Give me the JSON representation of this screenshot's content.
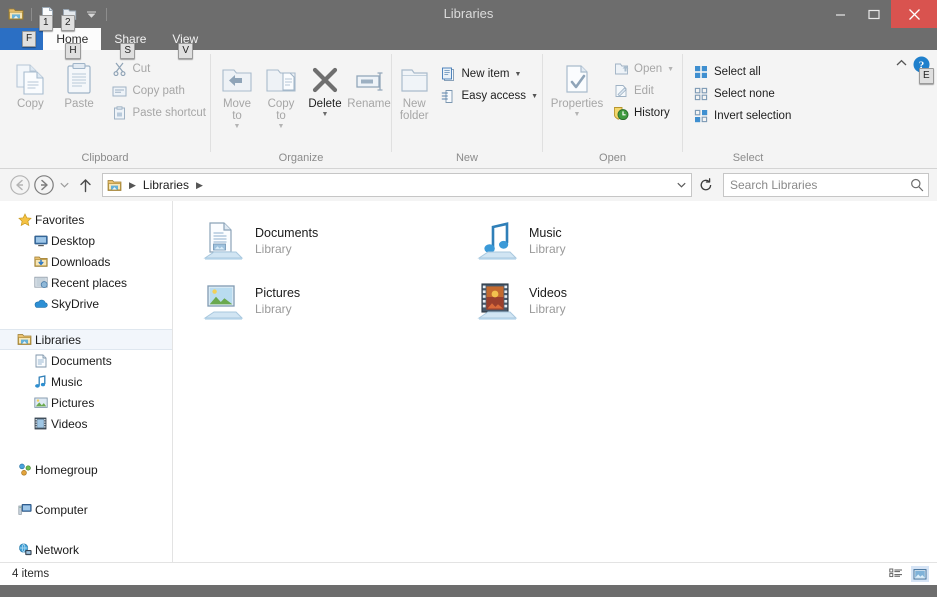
{
  "window": {
    "title": "Libraries",
    "controls": {
      "minimize": "minimize",
      "maximize": "maximize",
      "close": "close"
    }
  },
  "quick_access": {
    "keytips": [
      "1",
      "2"
    ],
    "dropdown": "customize-quick-access-toolbar"
  },
  "tabs": [
    {
      "label": "F",
      "name": "file-tab",
      "keytip": "F",
      "active": false
    },
    {
      "label": "Home",
      "name": "tab-home",
      "keytip": "H",
      "active": true
    },
    {
      "label": "Share",
      "name": "tab-share",
      "keytip": "S",
      "active": false
    },
    {
      "label": "View",
      "name": "tab-view",
      "keytip": "V",
      "active": false
    }
  ],
  "ribbon": {
    "help_keytip": "E",
    "groups": [
      {
        "label": "Clipboard",
        "big_buttons": [
          {
            "label": "Copy",
            "icon": "copy-icon",
            "disabled": true
          },
          {
            "label": "Paste",
            "icon": "paste-icon",
            "disabled": true
          }
        ],
        "small_buttons": [
          {
            "label": "Cut",
            "icon": "cut-icon",
            "disabled": true
          },
          {
            "label": "Copy path",
            "icon": "copy-path-icon",
            "disabled": true
          },
          {
            "label": "Paste shortcut",
            "icon": "paste-shortcut-icon",
            "disabled": true
          }
        ]
      },
      {
        "label": "Organize",
        "big_buttons": [
          {
            "label": "Move\nto",
            "icon": "move-to-icon",
            "disabled": true,
            "caret": true
          },
          {
            "label": "Copy\nto",
            "icon": "copy-to-icon",
            "disabled": true,
            "caret": true
          },
          {
            "label": "Delete",
            "icon": "delete-icon",
            "disabled": false,
            "caret": true
          },
          {
            "label": "Rename",
            "icon": "rename-icon",
            "disabled": true
          }
        ]
      },
      {
        "label": "New",
        "big_buttons": [
          {
            "label": "New\nfolder",
            "icon": "new-folder-icon",
            "disabled": true
          }
        ],
        "small_buttons": [
          {
            "label": "New item",
            "icon": "new-item-icon",
            "disabled": false,
            "caret": true
          },
          {
            "label": "Easy access",
            "icon": "easy-access-icon",
            "disabled": false,
            "caret": true
          }
        ]
      },
      {
        "label": "Open",
        "big_buttons": [
          {
            "label": "Properties",
            "icon": "properties-icon",
            "disabled": true,
            "caret": true
          }
        ],
        "small_buttons": [
          {
            "label": "Open",
            "icon": "open-icon",
            "disabled": true,
            "caret": true
          },
          {
            "label": "Edit",
            "icon": "edit-icon",
            "disabled": true
          },
          {
            "label": "History",
            "icon": "history-icon",
            "disabled": false
          }
        ]
      },
      {
        "label": "Select",
        "small_buttons": [
          {
            "label": "Select all",
            "icon": "select-all-icon",
            "disabled": false
          },
          {
            "label": "Select none",
            "icon": "select-none-icon",
            "disabled": false
          },
          {
            "label": "Invert selection",
            "icon": "invert-selection-icon",
            "disabled": false
          }
        ]
      }
    ]
  },
  "addressbar": {
    "back": "back-button",
    "forward": "forward-button",
    "recent": "recent-locations-button",
    "up": "up-button",
    "breadcrumb": [
      "Libraries"
    ],
    "refresh": "refresh-button",
    "search_placeholder": "Search Libraries"
  },
  "navpane": {
    "sections": [
      {
        "header": {
          "label": "Favorites",
          "icon": "star-icon"
        },
        "items": [
          {
            "label": "Desktop",
            "icon": "desktop-icon"
          },
          {
            "label": "Downloads",
            "icon": "downloads-icon"
          },
          {
            "label": "Recent places",
            "icon": "recent-places-icon"
          },
          {
            "label": "SkyDrive",
            "icon": "skydrive-icon"
          }
        ]
      },
      {
        "header": {
          "label": "Libraries",
          "icon": "libraries-icon",
          "selected": true
        },
        "items": [
          {
            "label": "Documents",
            "icon": "documents-icon"
          },
          {
            "label": "Music",
            "icon": "music-icon"
          },
          {
            "label": "Pictures",
            "icon": "pictures-icon"
          },
          {
            "label": "Videos",
            "icon": "videos-icon"
          }
        ]
      },
      {
        "header": {
          "label": "Homegroup",
          "icon": "homegroup-icon"
        },
        "items": []
      },
      {
        "header": {
          "label": "Computer",
          "icon": "computer-icon"
        },
        "items": []
      },
      {
        "header": {
          "label": "Network",
          "icon": "network-icon"
        },
        "items": []
      }
    ]
  },
  "content": {
    "tiles": [
      {
        "name": "Documents",
        "subtitle": "Library",
        "icon": "documents-library-icon"
      },
      {
        "name": "Music",
        "subtitle": "Library",
        "icon": "music-library-icon"
      },
      {
        "name": "Pictures",
        "subtitle": "Library",
        "icon": "pictures-library-icon"
      },
      {
        "name": "Videos",
        "subtitle": "Library",
        "icon": "videos-library-icon"
      }
    ]
  },
  "statusbar": {
    "item_count": "4 items",
    "views": [
      {
        "name": "details-view-button",
        "active": false
      },
      {
        "name": "large-icons-view-button",
        "active": true
      }
    ]
  },
  "colors": {
    "titlebar": "#6d6d6d",
    "file_tab": "#2b6fc4",
    "close_button": "#d9534f",
    "ribbon_bg": "#f4f4f4",
    "selection": "#f2f6fb"
  }
}
